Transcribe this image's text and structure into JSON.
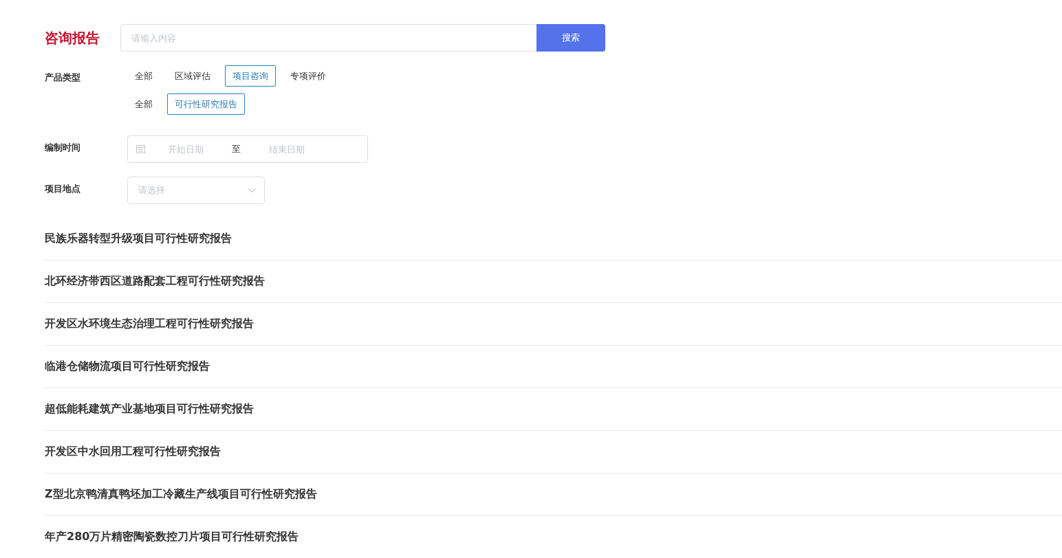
{
  "header": {
    "title": "咨询报告",
    "search": {
      "placeholder": "请输入内容",
      "button": "搜索"
    }
  },
  "product_type": {
    "label": "产品类型",
    "categories": [
      {
        "label": "全部",
        "selected": false
      },
      {
        "label": "区域评估",
        "selected": false
      },
      {
        "label": "项目咨询",
        "selected": true
      },
      {
        "label": "专项评价",
        "selected": false
      }
    ],
    "subcategories": [
      {
        "label": "全部",
        "selected": false
      },
      {
        "label": "可行性研究报告",
        "selected": true
      }
    ]
  },
  "compile_time": {
    "label": "编制时间",
    "start_placeholder": "开始日期",
    "separator": "至",
    "end_placeholder": "结束日期"
  },
  "location": {
    "label": "项目地点",
    "placeholder": "请选择"
  },
  "reports": [
    {
      "title": "民族乐器转型升级项目可行性研究报告"
    },
    {
      "title": "北环经济带西区道路配套工程可行性研究报告"
    },
    {
      "title": "开发区水环境生态治理工程可行性研究报告"
    },
    {
      "title": "临港仓储物流项目可行性研究报告"
    },
    {
      "title": "超低能耗建筑产业基地项目可行性研究报告"
    },
    {
      "title": "开发区中水回用工程可行性研究报告"
    },
    {
      "title": "Z型北京鸭清真鸭坯加工冷藏生产线项目可行性研究报告"
    },
    {
      "title": "年产280万片精密陶瓷数控刀片项目可行性研究报告"
    }
  ]
}
